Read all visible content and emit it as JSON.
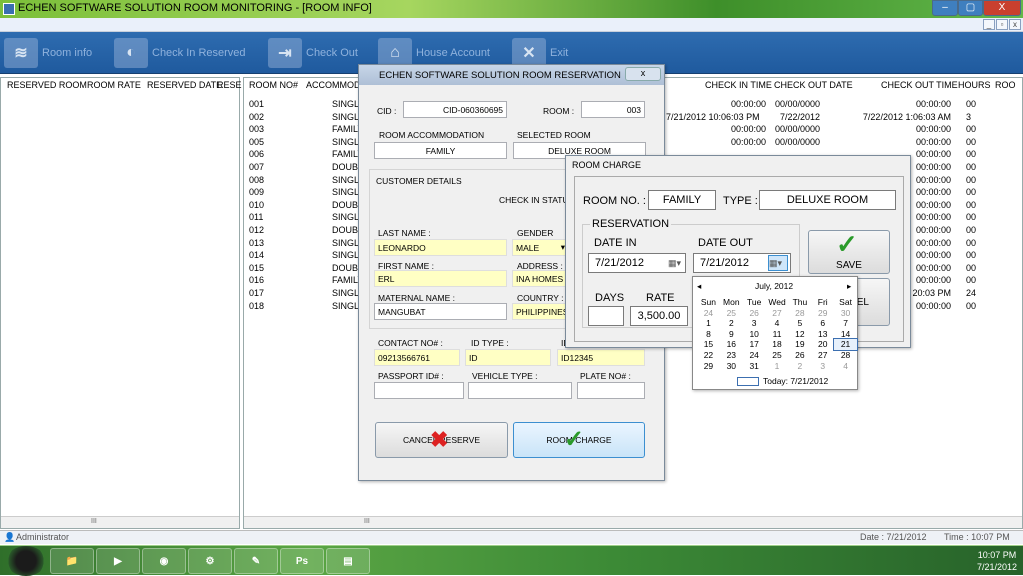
{
  "window": {
    "title": "ECHEN SOFTWARE SOLUTION ROOM MONITORING - [ROOM INFO]",
    "min": "–",
    "max": "▢",
    "close": "X"
  },
  "toolbar": [
    {
      "label": "Room info",
      "icon": "≋"
    },
    {
      "label": "Check In Reserved",
      "icon": "◐"
    },
    {
      "label": "Check Out",
      "icon": "⇥"
    },
    {
      "label": "House Account",
      "icon": "⌂"
    },
    {
      "label": "Exit",
      "icon": "✕"
    }
  ],
  "left_table": {
    "headers": [
      "RESERVED ROOM",
      "ROOM RATE",
      "RESERVED DATE",
      "RESE"
    ],
    "scroll_mark": "III"
  },
  "right_table": {
    "headers": [
      "ROOM NO#",
      "ACCOMMOD",
      "CHECK IN TIME",
      "CHECK OUT DATE",
      "CHECK OUT TIME",
      "HOURS",
      "ROO"
    ],
    "room_no": [
      "001",
      "002",
      "003",
      "005",
      "006",
      "007",
      "008",
      "009",
      "010",
      "011",
      "012",
      "013",
      "014",
      "015",
      "016",
      "017",
      "018"
    ],
    "accom": [
      "SINGLE",
      "SINGLE",
      "FAMILY",
      "SINGLE",
      "FAMILY",
      "DOUBL",
      "SINGLE",
      "SINGLE",
      "DOUBL",
      "SINGLE",
      "DOUBL",
      "SINGLE",
      "SINGLE",
      "DOUBL",
      "FAMILY",
      "SINGLE",
      "SINGLE"
    ],
    "checkin_date_partial": "7/21/2012 10:06:03 PM",
    "checkin_time": [
      "00:00:00",
      "",
      "00:00:00",
      "00:00:00"
    ],
    "checkout_date": [
      "00/00/0000",
      "7/22/2012",
      "00/00/0000",
      "00/00/0000"
    ],
    "checkout_time": [
      "00:00:00",
      "7/22/2012 1:06:03 AM",
      "00:00:00",
      "00:00:00",
      "00:00:00",
      "00:00:00",
      "00:00:00",
      "00:00:00",
      "00:00:00",
      "00:00:00",
      "00:00:00",
      "00:00:00",
      "00:00:00",
      "00:00:00",
      "00:00:00",
      "20:03 PM",
      "00:00:00"
    ],
    "hours": [
      "00",
      "3",
      "00",
      "00",
      "00",
      "00",
      "00",
      "00",
      "00",
      "00",
      "00",
      "00",
      "00",
      "00",
      "00",
      "24",
      "00"
    ],
    "scroll_mark": "III"
  },
  "status": {
    "user": "Administrator",
    "date": "Date : 7/21/2012",
    "time": "Time : 10:07 PM"
  },
  "reservation": {
    "title": "ECHEN SOFTWARE SOLUTION ROOM RESERVATION",
    "cid_label": "CID :",
    "cid": "CID-060360695",
    "room_label": "ROOM :",
    "room": "003",
    "accom_label": "ROOM ACCOMMODATION",
    "accom": "FAMILY",
    "selroom_label": "SELECTED ROOM",
    "selroom": "DELUXE ROOM",
    "cust_label": "CUSTOMER DETAILS",
    "checkin_status_label": "CHECK IN STATUS",
    "last_label": "LAST NAME :",
    "last": "LEONARDO",
    "gender_label": "GENDER",
    "gender": "MALE",
    "first_label": "FIRST NAME :",
    "first": "ERL",
    "address_label": "ADDRESS :",
    "address": "INA HOMES",
    "maternal_label": "MATERNAL NAME :",
    "maternal": "MANGUBAT",
    "country_label": "COUNTRY :",
    "country": "PHILIPPINES",
    "contact_label": "CONTACT NO# :",
    "contact": "09213566761",
    "idtype_label": "ID TYPE :",
    "idtype": "ID",
    "idno_label": "ID",
    "idno": "ID12345",
    "passport_label": "PASSPORT ID# :",
    "vehicle_label": "VEHICLE TYPE :",
    "plate_label": "PLATE NO# :",
    "cancel_label": "CANCEL RESERVE",
    "charge_label": "ROOM CHARGE"
  },
  "room_charge": {
    "title": "ROOM CHARGE",
    "room_no_label": "ROOM NO. :",
    "room_no": "FAMILY",
    "type_label": "TYPE :",
    "type": "DELUXE ROOM",
    "reservation_label": "RESERVATION",
    "date_in_label": "DATE IN",
    "date_in": "7/21/2012",
    "date_out_label": "DATE OUT",
    "date_out": "7/21/2012",
    "days_label": "DAYS",
    "days": "",
    "rate_label": "RATE",
    "rate": "3,500.00",
    "save_label": "SAVE",
    "cancel_partial": "EL"
  },
  "calendar": {
    "month": "July, 2012",
    "dow": [
      "Sun",
      "Mon",
      "Tue",
      "Wed",
      "Thu",
      "Fri",
      "Sat"
    ],
    "weeks": [
      [
        "24",
        "25",
        "26",
        "27",
        "28",
        "29",
        "30"
      ],
      [
        "1",
        "2",
        "3",
        "4",
        "5",
        "6",
        "7"
      ],
      [
        "8",
        "9",
        "10",
        "11",
        "12",
        "13",
        "14"
      ],
      [
        "15",
        "16",
        "17",
        "18",
        "19",
        "20",
        "21"
      ],
      [
        "22",
        "23",
        "24",
        "25",
        "26",
        "27",
        "28"
      ],
      [
        "29",
        "30",
        "31",
        "1",
        "2",
        "3",
        "4"
      ]
    ],
    "today": "Today: 7/21/2012"
  },
  "taskbar": {
    "time": "10:07 PM",
    "date": "7/21/2012",
    "apps": [
      "📁",
      "▶",
      "◉",
      "⚙",
      "✎",
      "Ps",
      "▤"
    ]
  }
}
